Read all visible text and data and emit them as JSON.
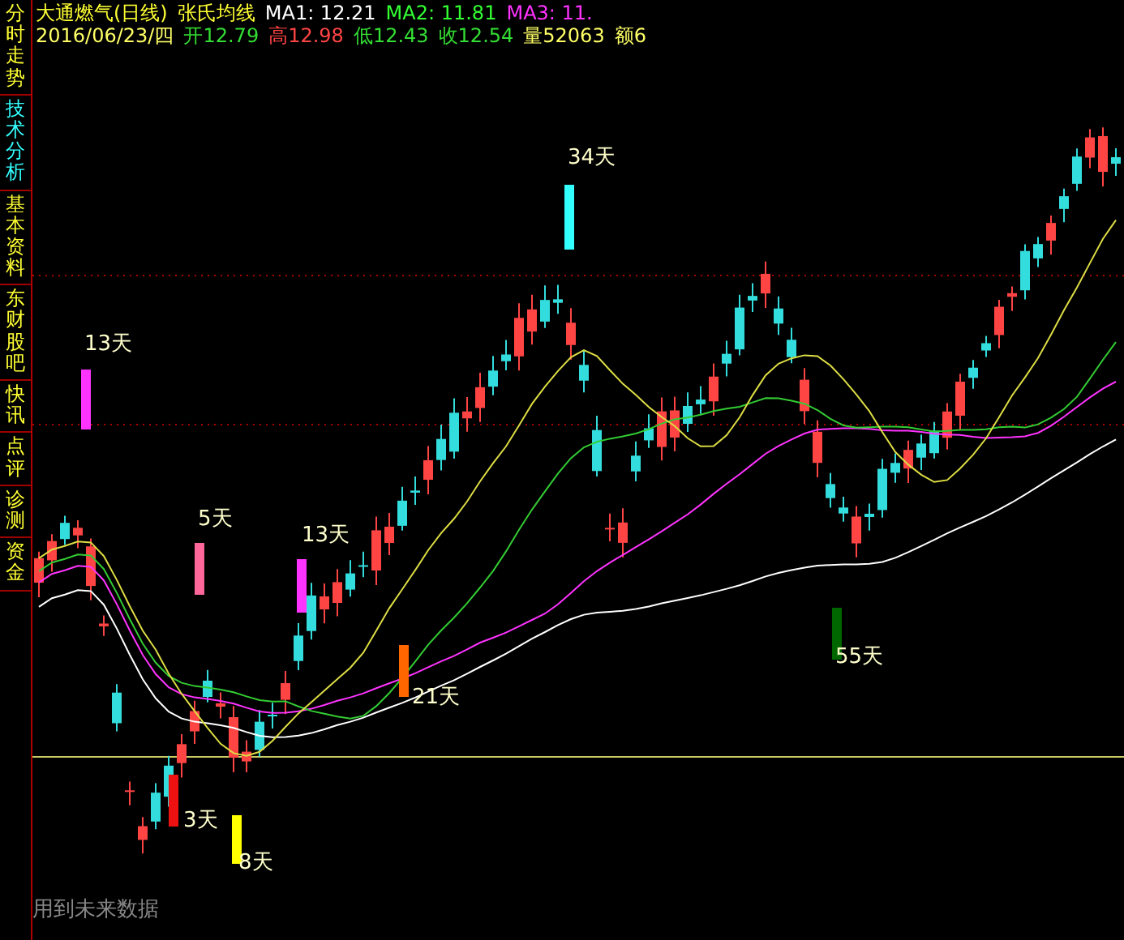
{
  "sidebar": {
    "tabs": [
      {
        "label": "分时走势",
        "selected": false
      },
      {
        "label": "技术分析",
        "selected": true
      },
      {
        "label": "基本资料",
        "selected": false
      },
      {
        "label": "东财股吧",
        "selected": false
      },
      {
        "label": "快讯",
        "selected": false
      },
      {
        "label": "点评",
        "selected": false
      },
      {
        "label": "诊测",
        "selected": false
      },
      {
        "label": "资金",
        "selected": false
      }
    ]
  },
  "header": {
    "title_line": [
      {
        "text": "大通燃气(日线)",
        "color": "#ffff33"
      },
      {
        "text": "张氏均线",
        "color": "#ffff33"
      },
      {
        "text": "MA1: 12.21",
        "color": "#ffffff"
      },
      {
        "text": "MA2: 11.81",
        "color": "#33ff33"
      },
      {
        "text": "MA3: 11.",
        "color": "#ff33ff"
      }
    ],
    "quote_line": [
      {
        "text": "2016/06/23/四",
        "color": "#ffff66"
      },
      {
        "text": "开12.79",
        "color": "#33dd33"
      },
      {
        "text": "高12.98",
        "color": "#ff4444"
      },
      {
        "text": "低12.43",
        "color": "#33dd33"
      },
      {
        "text": "收12.54",
        "color": "#33dd33"
      },
      {
        "text": "量52063",
        "color": "#ffff66"
      },
      {
        "text": "额6",
        "color": "#ffff66"
      }
    ]
  },
  "signals": [
    {
      "label": "13天",
      "color": "#ff33ff"
    },
    {
      "label": "5天",
      "color": "#ff6699"
    },
    {
      "label": "13天",
      "color": "#ff33ff"
    },
    {
      "label": "34天",
      "color": "#33ffff"
    },
    {
      "label": "21天",
      "color": "#ff6600"
    },
    {
      "label": "55天",
      "color": "#006600"
    },
    {
      "label": "3天",
      "color": "#ee1111"
    },
    {
      "label": "8天",
      "color": "#ffff00"
    }
  ],
  "footer_note": "用到未来数据"
}
